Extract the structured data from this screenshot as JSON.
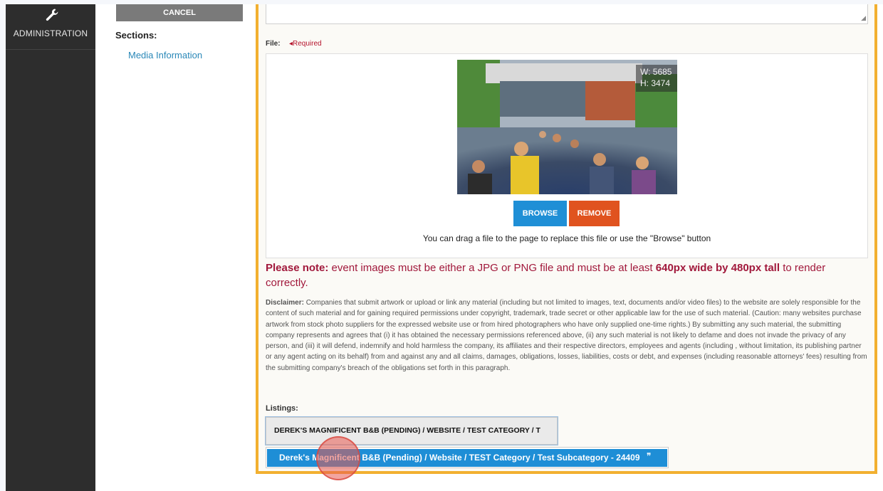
{
  "nav": {
    "admin_label": "ADMINISTRATION",
    "admin_icon": "wrench-icon"
  },
  "sidebar": {
    "cancel_label": "CANCEL",
    "sections_label": "Sections:",
    "section_link": "Media Information"
  },
  "file": {
    "label": "File:",
    "required": "◂Required",
    "width_label": "W: 5685",
    "height_label": "H: 3474",
    "browse_label": "BROWSE",
    "remove_label": "REMOVE",
    "drag_hint": "You can drag a file to the page to replace this file or use the \"Browse\" button"
  },
  "note": {
    "lead": "Please note:",
    "text1": " event images must be either a JPG or PNG file and must be at least ",
    "bold": "640px wide by 480px tall",
    "text2": " to render correctly."
  },
  "disclaimer": {
    "lead": "Disclaimer:",
    "text": " Companies that submit artwork or upload or link any material (including but not limited to images, text, documents and/or video files) to the website are solely responsible for the content of such material and for gaining required permissions under copyright, trademark, trade secret or other applicable law for the use of such material. (Caution: many websites purchase artwork from stock photo suppliers for the expressed website use or from hired photographers who have only supplied one-time rights.) By submitting any such material, the submitting company represents and agrees that (i) it has obtained the necessary permissions referenced above, (ii) any such material is not likely to defame and does not invade the privacy of any person, and (iii) it will defend, indemnify and hold harmless the company, its affiliates and their respective directors, employees and agents (including , without limitation, its publishing partner or any agent acting on its behalf) from and against any and all claims, damages, obligations, losses, liabilities, costs or debt, and expenses (including reasonable attorneys' fees) resulting from the submitting company's breach of the obligations set forth in this paragraph."
  },
  "listings": {
    "label": "Listings:",
    "selected": "DEREK'S MAGNIFICENT B&B (PENDING) / WEBSITE / TEST CATEGORY / T",
    "option": "Derek's Magnificent B&B (Pending) / Website / TEST Category / Test Subcategory - 24409"
  },
  "colors": {
    "accent_border": "#f2b030",
    "browse": "#1f8fd6",
    "remove": "#e0531f",
    "note": "#a1183b",
    "link": "#2a88b8"
  }
}
